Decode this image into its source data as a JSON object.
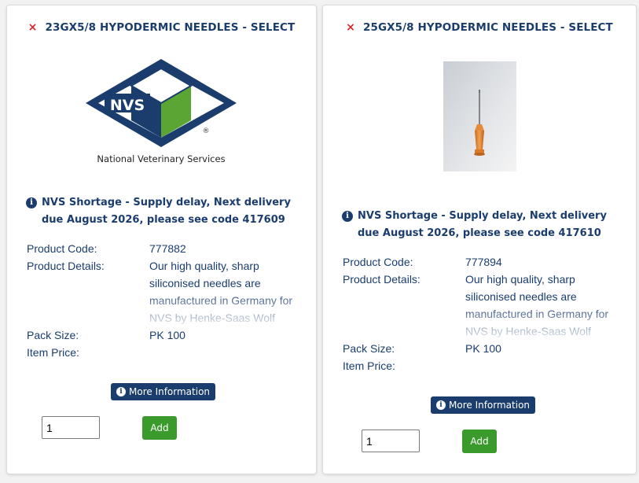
{
  "products": [
    {
      "remove_icon": "×",
      "title": "23GX5/8 HYPODERMIC NEEDLES - SELECT",
      "image": {
        "type": "logo",
        "logo_text": "NVS",
        "caption": "National Veterinary Services",
        "registered": "®"
      },
      "notice": "NVS Shortage - Supply delay, Next delivery due August 2026, please see code 417609",
      "info_glyph": "i",
      "specs": {
        "code_label": "Product Code:",
        "code": "777882",
        "details_label": "Product Details:",
        "details": "Our high quality, sharp siliconised needles are manufactured in Germany for NVS by Henke-Saas Wolf",
        "pack_label": "Pack Size:",
        "pack": "PK 100",
        "price_label": "Item Price:"
      },
      "more_info_label": "More Information",
      "quantity": "1",
      "add_label": "Add"
    },
    {
      "remove_icon": "×",
      "title": "25GX5/8 HYPODERMIC NEEDLES - SELECT",
      "image": {
        "type": "photo",
        "subject": "needle-photo"
      },
      "notice": "NVS Shortage - Supply delay, Next delivery due August 2026, please see code 417610",
      "info_glyph": "i",
      "specs": {
        "code_label": "Product Code:",
        "code": "777894",
        "details_label": "Product Details:",
        "details": "Our high quality, sharp siliconised needles are manufactured in Germany for NVS by Henke-Saas Wolf",
        "pack_label": "Pack Size:",
        "pack": "PK 100",
        "price_label": "Item Price:"
      },
      "more_info_label": "More Information",
      "quantity": "1",
      "add_label": "Add"
    }
  ],
  "colors": {
    "brand_blue": "#1a3d6e",
    "remove_red": "#d9262c",
    "add_green": "#3a9a2c",
    "logo_green": "#5ba534"
  }
}
